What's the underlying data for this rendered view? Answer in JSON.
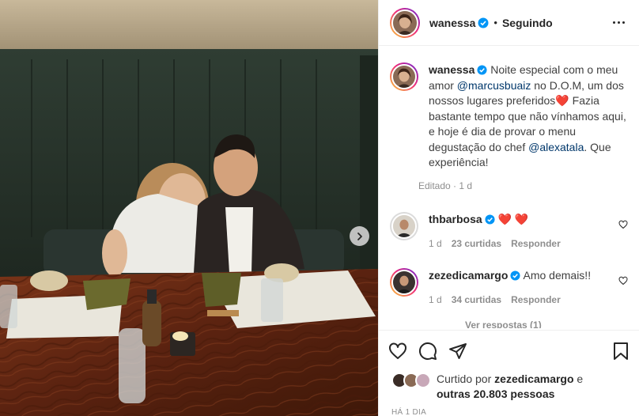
{
  "colors": {
    "accent_blue": "#0095f6",
    "mention": "#00376b",
    "heart_red": "#ff3040",
    "muted": "#8e8e8e",
    "text": "#262626"
  },
  "icons": {
    "next": "chevron-right-icon",
    "verified": "verified-badge-icon",
    "more": "more-options-icon",
    "like": "heart-outline-icon",
    "comment": "comment-bubble-icon",
    "share": "paper-plane-icon",
    "save": "bookmark-icon"
  },
  "header": {
    "username": "wanessa",
    "separator": "•",
    "follow_status": "Seguindo"
  },
  "caption": {
    "username": "wanessa",
    "text_1": "Noite especial com o meu amor",
    "mention_1": "@marcusbuaiz",
    "text_2": "no D.O.M, um dos nossos lugares preferidos",
    "emoji": "❤️",
    "text_3": "Fazia bastante tempo que não vínhamos aqui, e hoje é dia de provar o menu degustação do chef",
    "mention_2": "@alexatala",
    "text_4": ". Que experiência!",
    "meta": "Editado · 1 d"
  },
  "comments": [
    {
      "username": "thbarbosa",
      "text": "❤️ ❤️",
      "time": "1 d",
      "likes": "23 curtidas",
      "reply": "Responder"
    },
    {
      "username": "zezedicamargo",
      "text": "Amo demais!!",
      "time": "1 d",
      "likes": "34 curtidas",
      "reply": "Responder"
    }
  ],
  "view_replies": "Ver respostas (1)",
  "likes": {
    "prefix": "Curtido por",
    "user": "zezedicamargo",
    "suffix": "e",
    "others": "outras 20.803 pessoas"
  },
  "time_ago": "HÁ 1 DIA"
}
